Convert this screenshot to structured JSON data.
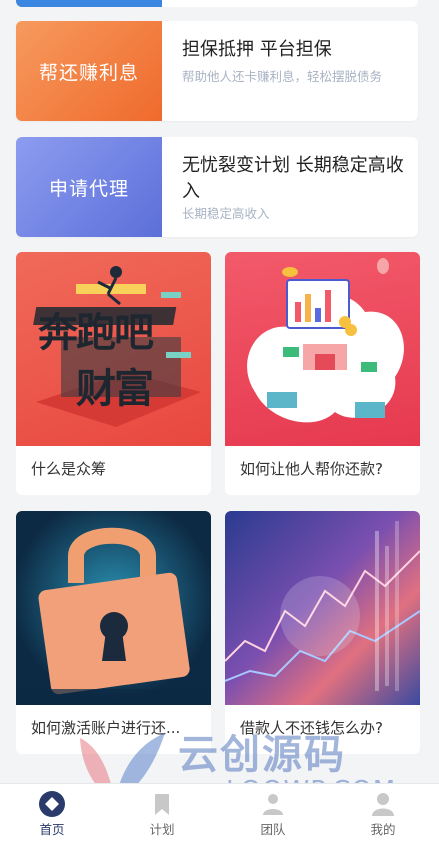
{
  "promos": [
    {
      "thumb_text": "帮还赚利息",
      "title": "担保抵押 平台担保",
      "subtitle": "帮助他人还卡赚利息，轻松摆脱债务"
    },
    {
      "thumb_text": "申请代理",
      "title": "无忧裂变计划 长期稳定高收入",
      "subtitle": "长期稳定高收入"
    }
  ],
  "cards": [
    {
      "caption": "什么是众筹",
      "art_text_1": "奔跑吧",
      "art_text_2": "财富"
    },
    {
      "caption": "如何让他人帮你还款?"
    },
    {
      "caption": "如何激活账户进行还..."
    },
    {
      "caption": "借款人不还钱怎么办?"
    }
  ],
  "watermark": {
    "brand": "云创源码",
    "url": "LOOWP.COM"
  },
  "tabbar": [
    {
      "label": "首页",
      "icon": "home-icon",
      "active": true
    },
    {
      "label": "计划",
      "icon": "bookmark-icon",
      "active": false
    },
    {
      "label": "团队",
      "icon": "team-icon",
      "active": false
    },
    {
      "label": "我的",
      "icon": "user-icon",
      "active": false
    }
  ],
  "colors": {
    "orange": "#f2793b",
    "indigo": "#6a7fe0",
    "blue": "#3b86e0",
    "nav_active": "#2a3a6a"
  }
}
